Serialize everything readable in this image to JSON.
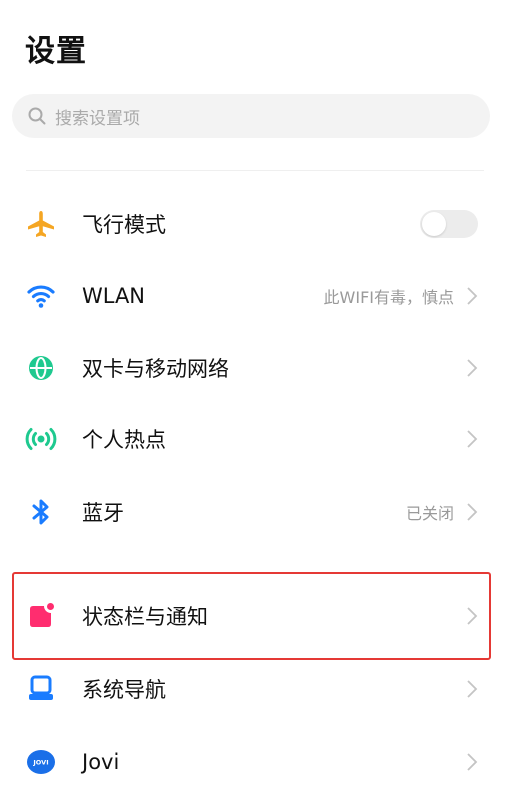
{
  "header": {
    "title": "设置"
  },
  "search": {
    "placeholder": "搜索设置项"
  },
  "items": [
    {
      "label": "飞行模式",
      "icon": "airplane-icon",
      "color": "#f5a623",
      "toggle_on": false
    },
    {
      "label": "WLAN",
      "value": "此WIFI有毒，慎点",
      "icon": "wifi-icon",
      "color": "#1a7cff"
    },
    {
      "label": "双卡与移动网络",
      "icon": "globe-icon",
      "color": "#1ec98f"
    },
    {
      "label": "个人热点",
      "icon": "hotspot-icon",
      "color": "#1ec98f"
    },
    {
      "label": "蓝牙",
      "value": "已关闭",
      "icon": "bluetooth-icon",
      "color": "#1a7cff"
    },
    {
      "label": "状态栏与通知",
      "icon": "notification-icon",
      "color": "#ff2d6f",
      "highlighted": true
    },
    {
      "label": "系统导航",
      "icon": "navigation-icon",
      "color": "#1a7cff"
    },
    {
      "label": "Jovi",
      "icon": "jovi-icon",
      "color": "#1a6fe8",
      "badge": "JOVI"
    }
  ]
}
